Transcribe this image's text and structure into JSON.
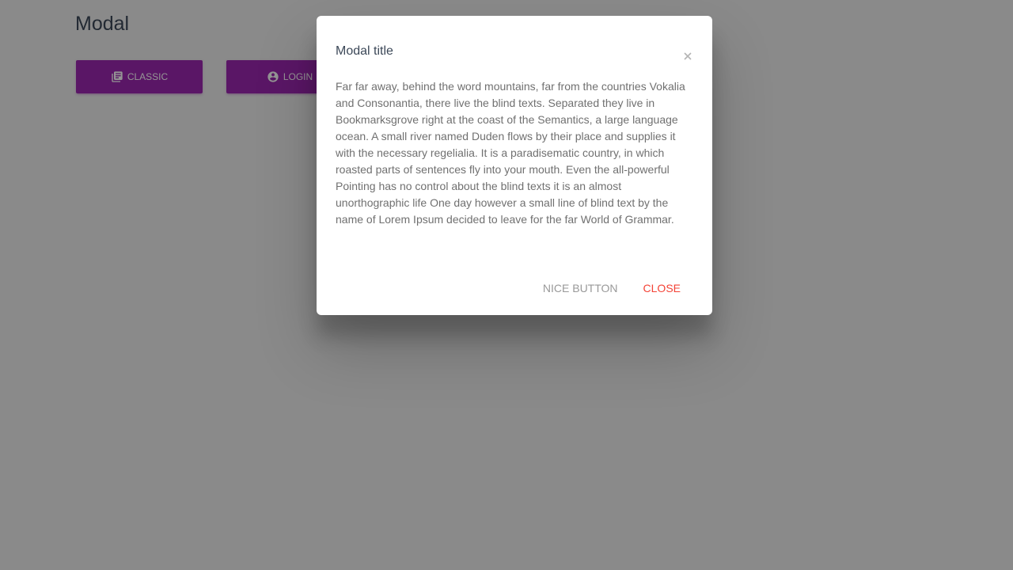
{
  "page": {
    "title": "Modal",
    "buttons": [
      {
        "label": "Classic",
        "icon": "library-books-icon"
      },
      {
        "label": "Login",
        "icon": "account-circle-icon"
      }
    ]
  },
  "modal": {
    "title": "Modal title",
    "body": "Far far away, behind the word mountains, far from the countries Vokalia and Consonantia, there live the blind texts. Separated they live in Bookmarksgrove right at the coast of the Semantics, a large language ocean. A small river named Duden flows by their place and supplies it with the necessary regelialia. It is a paradisematic country, in which roasted parts of sentences fly into your mouth. Even the all-powerful Pointing has no control about the blind texts it is an almost unorthographic life One day however a small line of blind text by the name of Lorem Ipsum decided to leave for the far World of Grammar.",
    "close_icon": "close-icon",
    "footer": {
      "nice_label": "Nice Button",
      "close_label": "Close"
    }
  },
  "colors": {
    "primary": "#9c27b0",
    "danger": "#f44336",
    "backdrop": "rgba(0,0,0,0.42)"
  }
}
